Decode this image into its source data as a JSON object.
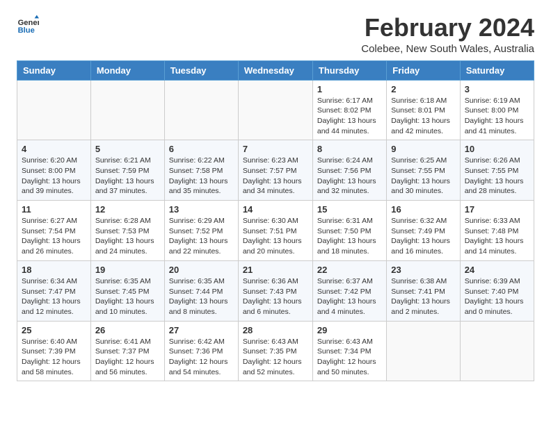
{
  "header": {
    "logo_general": "General",
    "logo_blue": "Blue",
    "month_year": "February 2024",
    "location": "Colebee, New South Wales, Australia"
  },
  "calendar": {
    "days_of_week": [
      "Sunday",
      "Monday",
      "Tuesday",
      "Wednesday",
      "Thursday",
      "Friday",
      "Saturday"
    ],
    "weeks": [
      [
        {
          "day": "",
          "info": ""
        },
        {
          "day": "",
          "info": ""
        },
        {
          "day": "",
          "info": ""
        },
        {
          "day": "",
          "info": ""
        },
        {
          "day": "1",
          "info": "Sunrise: 6:17 AM\nSunset: 8:02 PM\nDaylight: 13 hours\nand 44 minutes."
        },
        {
          "day": "2",
          "info": "Sunrise: 6:18 AM\nSunset: 8:01 PM\nDaylight: 13 hours\nand 42 minutes."
        },
        {
          "day": "3",
          "info": "Sunrise: 6:19 AM\nSunset: 8:00 PM\nDaylight: 13 hours\nand 41 minutes."
        }
      ],
      [
        {
          "day": "4",
          "info": "Sunrise: 6:20 AM\nSunset: 8:00 PM\nDaylight: 13 hours\nand 39 minutes."
        },
        {
          "day": "5",
          "info": "Sunrise: 6:21 AM\nSunset: 7:59 PM\nDaylight: 13 hours\nand 37 minutes."
        },
        {
          "day": "6",
          "info": "Sunrise: 6:22 AM\nSunset: 7:58 PM\nDaylight: 13 hours\nand 35 minutes."
        },
        {
          "day": "7",
          "info": "Sunrise: 6:23 AM\nSunset: 7:57 PM\nDaylight: 13 hours\nand 34 minutes."
        },
        {
          "day": "8",
          "info": "Sunrise: 6:24 AM\nSunset: 7:56 PM\nDaylight: 13 hours\nand 32 minutes."
        },
        {
          "day": "9",
          "info": "Sunrise: 6:25 AM\nSunset: 7:55 PM\nDaylight: 13 hours\nand 30 minutes."
        },
        {
          "day": "10",
          "info": "Sunrise: 6:26 AM\nSunset: 7:55 PM\nDaylight: 13 hours\nand 28 minutes."
        }
      ],
      [
        {
          "day": "11",
          "info": "Sunrise: 6:27 AM\nSunset: 7:54 PM\nDaylight: 13 hours\nand 26 minutes."
        },
        {
          "day": "12",
          "info": "Sunrise: 6:28 AM\nSunset: 7:53 PM\nDaylight: 13 hours\nand 24 minutes."
        },
        {
          "day": "13",
          "info": "Sunrise: 6:29 AM\nSunset: 7:52 PM\nDaylight: 13 hours\nand 22 minutes."
        },
        {
          "day": "14",
          "info": "Sunrise: 6:30 AM\nSunset: 7:51 PM\nDaylight: 13 hours\nand 20 minutes."
        },
        {
          "day": "15",
          "info": "Sunrise: 6:31 AM\nSunset: 7:50 PM\nDaylight: 13 hours\nand 18 minutes."
        },
        {
          "day": "16",
          "info": "Sunrise: 6:32 AM\nSunset: 7:49 PM\nDaylight: 13 hours\nand 16 minutes."
        },
        {
          "day": "17",
          "info": "Sunrise: 6:33 AM\nSunset: 7:48 PM\nDaylight: 13 hours\nand 14 minutes."
        }
      ],
      [
        {
          "day": "18",
          "info": "Sunrise: 6:34 AM\nSunset: 7:47 PM\nDaylight: 13 hours\nand 12 minutes."
        },
        {
          "day": "19",
          "info": "Sunrise: 6:35 AM\nSunset: 7:45 PM\nDaylight: 13 hours\nand 10 minutes."
        },
        {
          "day": "20",
          "info": "Sunrise: 6:35 AM\nSunset: 7:44 PM\nDaylight: 13 hours\nand 8 minutes."
        },
        {
          "day": "21",
          "info": "Sunrise: 6:36 AM\nSunset: 7:43 PM\nDaylight: 13 hours\nand 6 minutes."
        },
        {
          "day": "22",
          "info": "Sunrise: 6:37 AM\nSunset: 7:42 PM\nDaylight: 13 hours\nand 4 minutes."
        },
        {
          "day": "23",
          "info": "Sunrise: 6:38 AM\nSunset: 7:41 PM\nDaylight: 13 hours\nand 2 minutes."
        },
        {
          "day": "24",
          "info": "Sunrise: 6:39 AM\nSunset: 7:40 PM\nDaylight: 13 hours\nand 0 minutes."
        }
      ],
      [
        {
          "day": "25",
          "info": "Sunrise: 6:40 AM\nSunset: 7:39 PM\nDaylight: 12 hours\nand 58 minutes."
        },
        {
          "day": "26",
          "info": "Sunrise: 6:41 AM\nSunset: 7:37 PM\nDaylight: 12 hours\nand 56 minutes."
        },
        {
          "day": "27",
          "info": "Sunrise: 6:42 AM\nSunset: 7:36 PM\nDaylight: 12 hours\nand 54 minutes."
        },
        {
          "day": "28",
          "info": "Sunrise: 6:43 AM\nSunset: 7:35 PM\nDaylight: 12 hours\nand 52 minutes."
        },
        {
          "day": "29",
          "info": "Sunrise: 6:43 AM\nSunset: 7:34 PM\nDaylight: 12 hours\nand 50 minutes."
        },
        {
          "day": "",
          "info": ""
        },
        {
          "day": "",
          "info": ""
        }
      ]
    ]
  }
}
